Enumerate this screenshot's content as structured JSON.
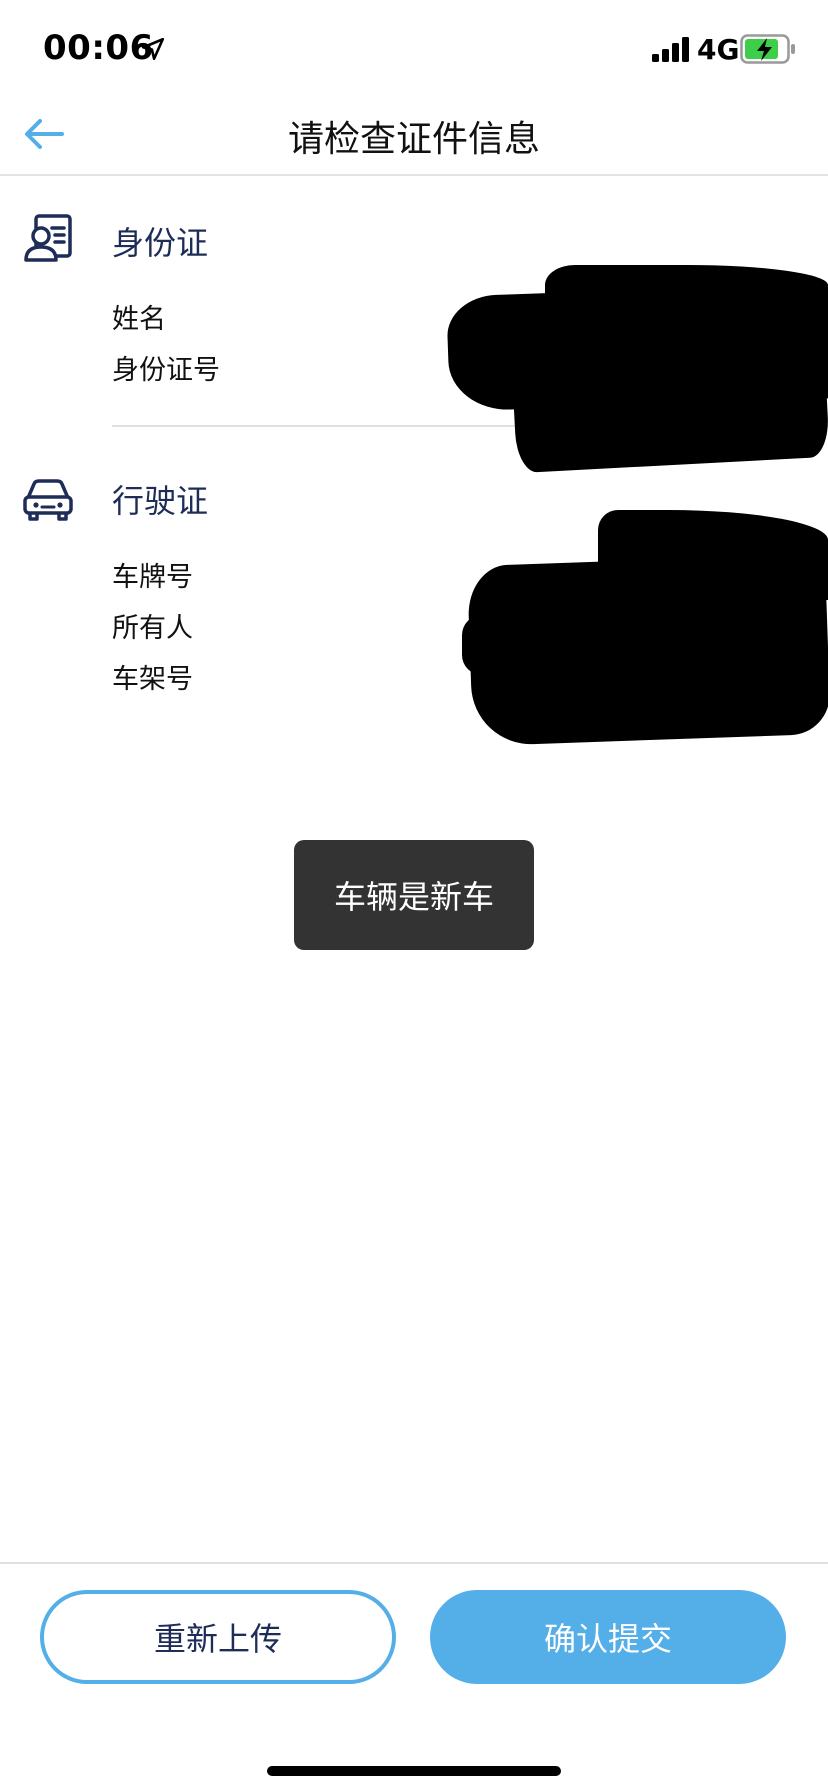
{
  "status_bar": {
    "time": "00:06",
    "network": "4G",
    "location_icon": "location-arrow-icon",
    "signal_icon": "cellular-signal-icon",
    "battery_icon": "battery-charging-icon"
  },
  "nav": {
    "title": "请检查证件信息",
    "back_icon": "arrow-left-icon"
  },
  "sections": {
    "id_card": {
      "title": "身份证",
      "icon": "id-card-icon",
      "fields": [
        "姓名",
        "身份证号"
      ]
    },
    "vehicle_license": {
      "title": "行驶证",
      "icon": "car-icon",
      "fields": [
        "车牌号",
        "所有人",
        "车架号"
      ]
    }
  },
  "toast": {
    "message": "车辆是新车"
  },
  "buttons": {
    "reupload": "重新上传",
    "confirm": "确认提交"
  },
  "colors": {
    "accent": "#54aee8",
    "section_title": "#1e2d58",
    "toast_bg": "#333333"
  }
}
